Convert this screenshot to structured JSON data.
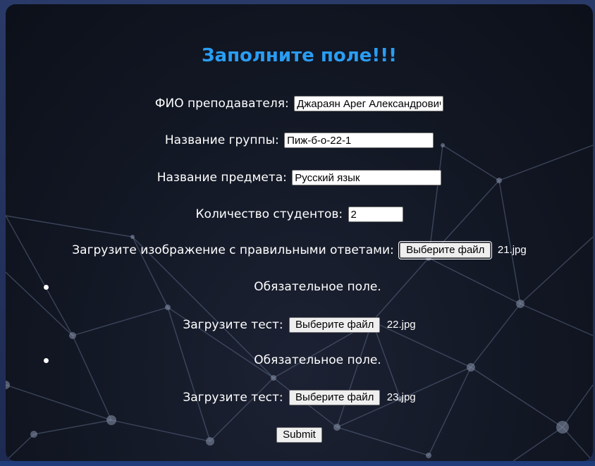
{
  "form": {
    "title": "Заполните поле!!!",
    "teacher": {
      "label": "ФИО преподавателя:",
      "value": "Джараян Арег Александрович"
    },
    "group": {
      "label": "Название группы:",
      "value": "Пиж-б-о-22-1"
    },
    "subject": {
      "label": "Название предмета:",
      "value": "Русский язык"
    },
    "students": {
      "label": "Количество студентов:",
      "value": "2"
    },
    "answers_upload": {
      "label": "Загрузите изображение с правильными ответами:",
      "button": "Выберите файл",
      "file": "21.jpg"
    },
    "tests": [
      {
        "required_note": "Обязательное поле.",
        "label": "Загрузите тест:",
        "button": "Выберите файл",
        "file": "22.jpg"
      },
      {
        "required_note": "Обязательное поле.",
        "label": "Загрузите тест:",
        "button": "Выберите файл",
        "file": "23.jpg"
      }
    ],
    "submit": "Submit"
  },
  "colors": {
    "title": "#2a9df4",
    "background": "#121724",
    "text": "#ffffff"
  }
}
